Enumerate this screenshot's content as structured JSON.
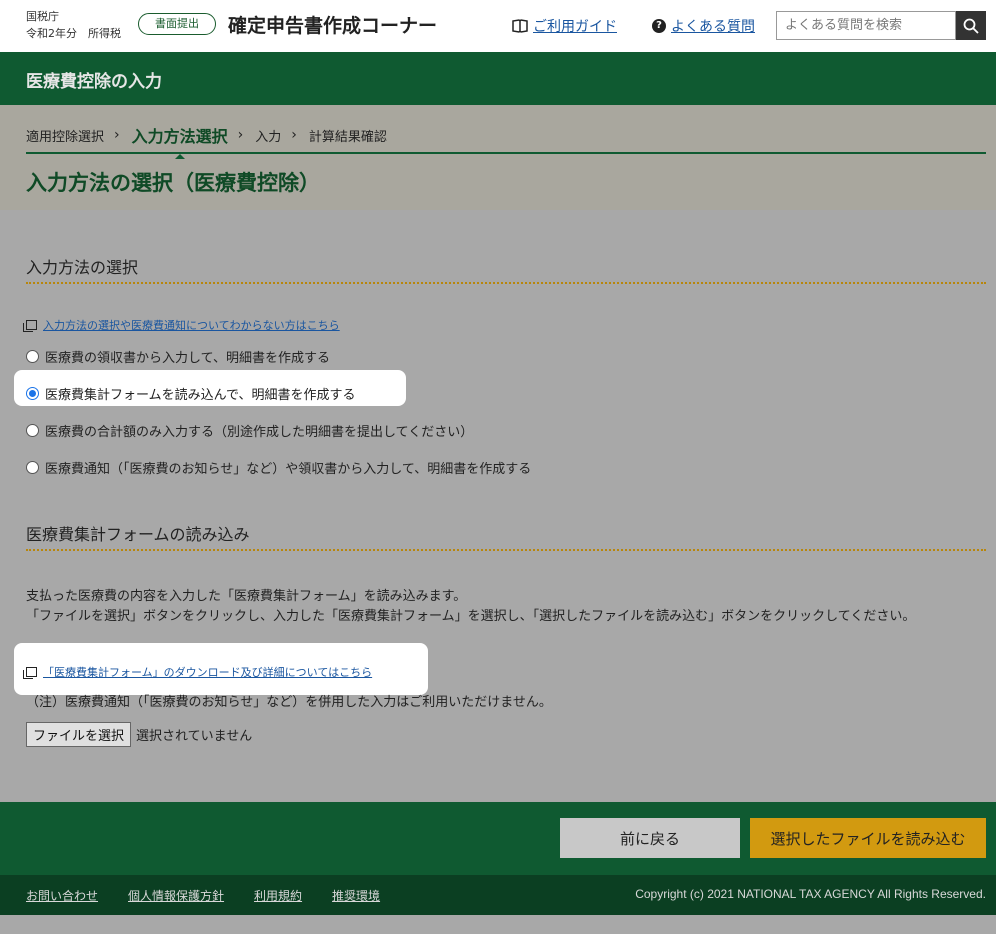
{
  "header": {
    "agency": "国税庁",
    "year_tax": "令和2年分　所得税",
    "badge": "書面提出",
    "app_title": "確定申告書作成コーナー",
    "guide": "ご利用ガイド",
    "faq": "よくある質問",
    "search_placeholder": "よくある質問を検索"
  },
  "band": {
    "title": "医療費控除の入力"
  },
  "steps": {
    "items": [
      "適用控除選択",
      "入力方法選択",
      "入力",
      "計算結果確認"
    ],
    "arrow": "›",
    "current_index": 1
  },
  "page_title": "入力方法の選択（医療費控除）",
  "section1": {
    "heading": "入力方法の選択",
    "help_link": "入力方法の選択や医療費通知についてわからない方はこちら",
    "options": [
      {
        "label": "医療費の領収書から入力して、明細書を作成する",
        "selected": false
      },
      {
        "label": "医療費集計フォームを読み込んで、明細書を作成する",
        "selected": true
      },
      {
        "label": "医療費の合計額のみ入力する（別途作成した明細書を提出してください）",
        "selected": false
      },
      {
        "label": "医療費通知（「医療費のお知らせ」など）や領収書から入力して、明細書を作成する",
        "selected": false
      }
    ]
  },
  "section2": {
    "heading": "医療費集計フォームの読み込み",
    "para1": "支払った医療費の内容を入力した「医療費集計フォーム」を読み込みます。",
    "para2": "「ファイルを選択」ボタンをクリックし、入力した「医療費集計フォーム」を選択し、「選択したファイルを読み込む」ボタンをクリックしてください。",
    "download_link": "「医療費集計フォーム」のダウンロード及び詳細についてはこちら",
    "note": "（注）医療費通知（「医療費のお知らせ」など）を併用した入力はご利用いただけません。",
    "file_button": "ファイルを選択",
    "file_status": "選択されていません"
  },
  "actions": {
    "back": "前に戻る",
    "load": "選択したファイルを読み込む"
  },
  "footer": {
    "links": [
      "お問い合わせ",
      "個人情報保護方針",
      "利用規約",
      "推奨環境"
    ],
    "copyright": "Copyright (c) 2021 NATIONAL TAX AGENCY All Rights Reserved."
  }
}
